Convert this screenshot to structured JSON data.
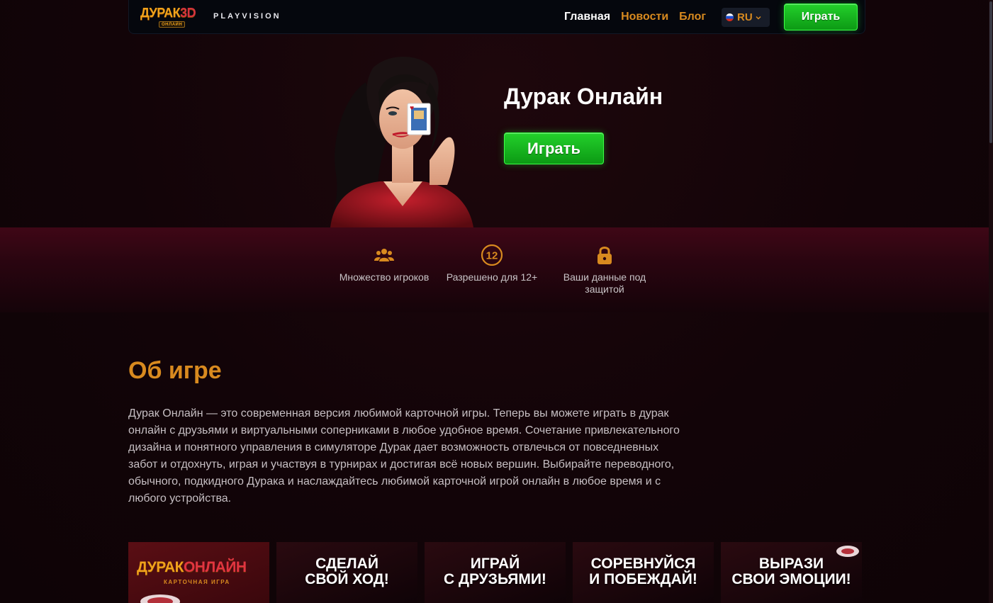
{
  "header": {
    "logo_text": "ДУРАК",
    "logo_3d": "3D",
    "logo_sub": "ОНЛАЙН",
    "brand": "PLAYVISION",
    "nav": [
      {
        "label": "Главная",
        "active": true
      },
      {
        "label": "Новости",
        "active": false
      },
      {
        "label": "Блог",
        "active": false
      }
    ],
    "lang": "RU",
    "play_label": "Играть"
  },
  "hero": {
    "title": "Дурак Онлайн",
    "play_label": "Играть"
  },
  "features": [
    {
      "icon": "users-icon",
      "text": "Множество игроков"
    },
    {
      "icon": "age-12-icon",
      "icon_text": "12",
      "text": "Разрешено для 12+"
    },
    {
      "icon": "lock-icon",
      "text": "Ваши данные под защитой"
    }
  ],
  "about": {
    "title": "Об игре",
    "text": "Дурак Онлайн — это современная версия любимой карточной игры. Теперь вы можете играть в дурак онлайн с друзьями и виртуальными соперниками в любое удобное время. Сочетание привлекательного дизайна и понятного управления в симуляторе Дурак дает возможность отвлечься от повседневных забот и отдохнуть, играя и участвуя в турнирах и достигая всё новых вершин. Выбирайте переводного, обычного, подкидного Дурака и наслаждайтесь любимой карточной игрой онлайн в любое время и с любого устройства."
  },
  "cards": {
    "logo_main": "ДУРАК",
    "logo_accent": "ОНЛАЙН",
    "logo_sub": "КАРТОЧНАЯ ИГРА",
    "items": [
      {
        "line1": "СДЕЛАЙ",
        "line2": "СВОЙ ХОД!"
      },
      {
        "line1": "ИГРАЙ",
        "line2": "С ДРУЗЬЯМИ!"
      },
      {
        "line1": "СОРЕВНУЙСЯ",
        "line2": "И ПОБЕЖДАЙ!"
      },
      {
        "line1": "ВЫРАЗИ",
        "line2": "СВОИ ЭМОЦИИ!"
      }
    ]
  },
  "colors": {
    "accent": "#d88a1f",
    "button_green": "#1ec626",
    "background": "#130408"
  }
}
